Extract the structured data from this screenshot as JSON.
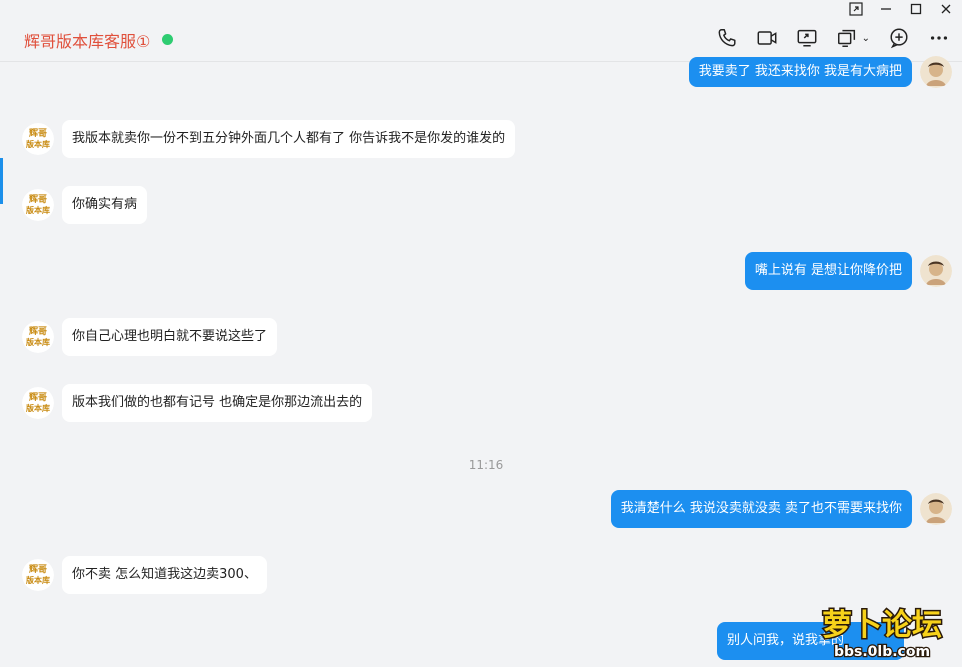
{
  "window": {
    "title": "辉哥版本库客服①",
    "controls": [
      "pin-icon",
      "minimize-icon",
      "maximize-icon",
      "close-icon"
    ]
  },
  "toolbar": [
    "phone-icon",
    "video-icon",
    "screen-share-icon",
    "remote-assist-icon",
    "add-member-icon",
    "more-icon"
  ],
  "colors": {
    "title": "#e0503c",
    "online": "#2ecc71",
    "bubble_out": "#1c8ff0",
    "bubble_in": "#ffffff",
    "accent": "#1c8fea"
  },
  "messages": [
    {
      "side": "out",
      "text": "我要卖了 我还来找你 我是有大病把"
    },
    {
      "side": "in",
      "text": "我版本就卖你一份不到五分钟外面几个人都有了 你告诉我不是你发的谁发的"
    },
    {
      "side": "in",
      "text": "你确实有病"
    },
    {
      "side": "out",
      "text": "嘴上说有 是想让你降价把"
    },
    {
      "side": "in",
      "text": "你自己心理也明白就不要说这些了"
    },
    {
      "side": "in",
      "text": "版本我们做的也都有记号 也确定是你那边流出去的"
    },
    {
      "side": "out",
      "text": "我清楚什么 我说没卖就没卖 卖了也不需要来找你"
    },
    {
      "side": "in",
      "text": "你不卖 怎么知道我这边卖300、"
    },
    {
      "side": "out",
      "text": "别人问我，说我拿的"
    }
  ],
  "timestamp": "11:16",
  "watermark": {
    "brand": "萝卜论坛",
    "url": "bbs.0lb.com"
  },
  "avatar_in_text": [
    "辉哥",
    "版本库"
  ]
}
